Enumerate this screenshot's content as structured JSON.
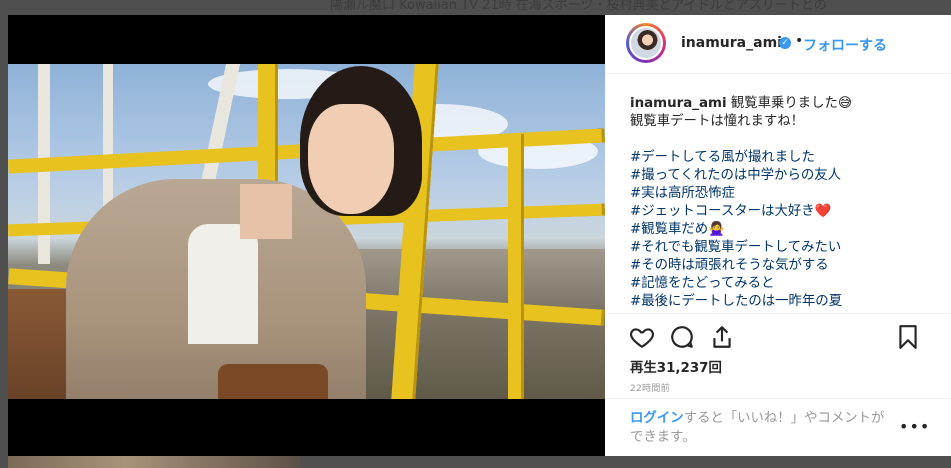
{
  "background": {
    "article_snippet": "陽瀬ル魔口 Kowaiian TV 21時 在海スポーツ・桜村典美とアイドルとアスリートとの"
  },
  "post": {
    "username": "inamura_ami",
    "verified_icon": "verified-badge-icon",
    "separator": "•",
    "follow_label": "フォローする",
    "caption_username": "inamura_ami",
    "caption_line1": " 観覧車乗りました😅",
    "caption_line2": "観覧車デートは憧れますね！",
    "hashtags": [
      "#デートしてる風が撮れました",
      "#撮ってくれたのは中学からの友人",
      "#実は高所恐怖症",
      "#ジェットコースターは大好き❤️",
      "#観覧車だめ🙅‍♀️",
      "#それでも観覧車デートしてみたい",
      "#その時は頑張れそうな気がする",
      "#記憶をたどってみると",
      "#最後にデートしたのは一昨年の夏"
    ],
    "view_count": "再生31,237回",
    "timestamp": "22時間前",
    "login_link": "ログイン",
    "login_rest": "すると「いいね！」やコメントができます。",
    "more_label": "•••"
  },
  "icons": {
    "like": "heart-outline-icon",
    "comment": "comment-bubble-icon",
    "share": "share-arrow-icon",
    "save": "bookmark-icon"
  }
}
